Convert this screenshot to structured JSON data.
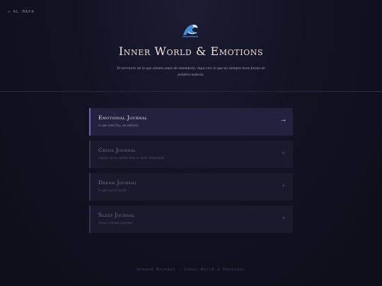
{
  "nav": {
    "back_arrow": "←",
    "back_label": "AL MAPA"
  },
  "hero": {
    "icon": "wave-icon"
  },
  "header": {
    "title": "Inner World & Emotions",
    "subtitle": "El territorio de lo que sientes antes de entenderlo. Aquí vive lo que no siempre tiene forma de palabra todavía."
  },
  "journals": [
    {
      "title": "Emotional Journal",
      "description": "lo que sentí hoy, sin editarlo",
      "action": "→",
      "active": true
    },
    {
      "title": "Crisis Journal",
      "description": "registro para cuando todo se siente demasiado",
      "action": "+",
      "active": false
    },
    {
      "title": "Dream Journal",
      "description": "lo que trae la noche",
      "action": "+",
      "active": false
    },
    {
      "title": "Sleep Journal",
      "description": "horas, calidad, patrones",
      "action": "+",
      "active": false
    }
  ],
  "footer": {
    "text": "Armand Michael · Inner World & Emotions"
  },
  "colors": {
    "accent": "#6a67b0",
    "title": "#efe6d6",
    "background": "#121222"
  }
}
